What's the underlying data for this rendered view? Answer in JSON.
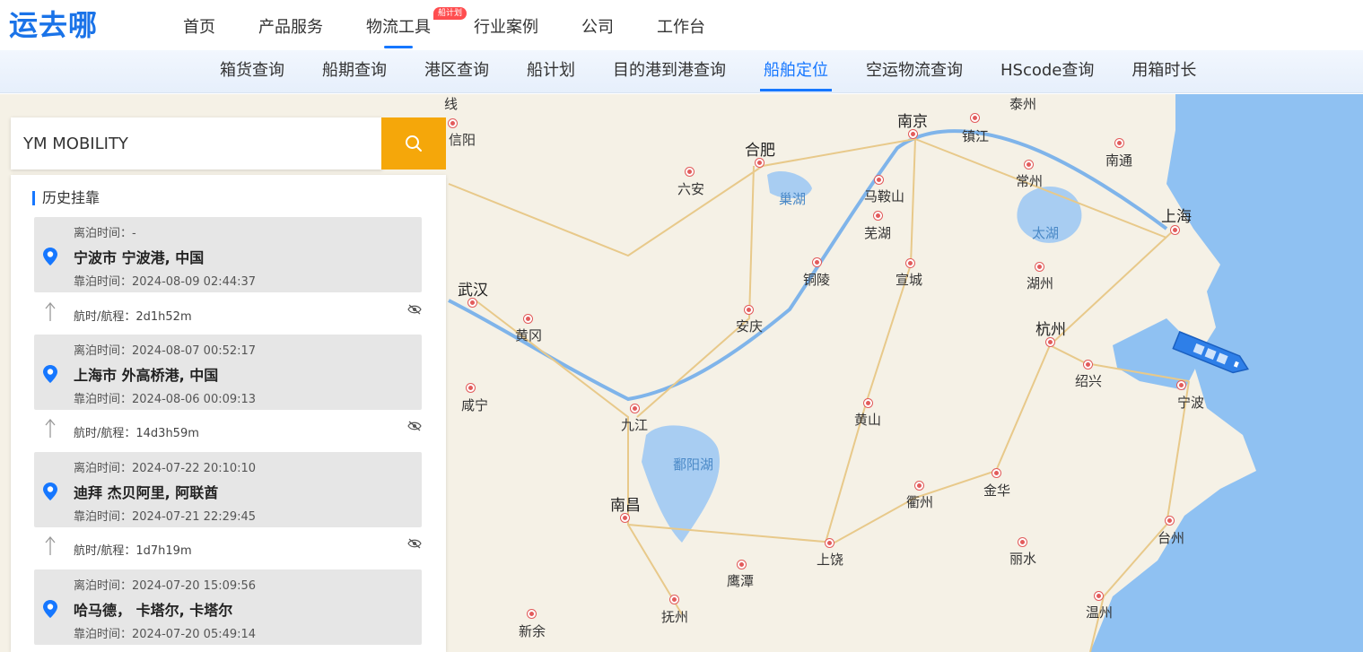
{
  "header": {
    "logo": "运去哪",
    "nav": [
      {
        "label": "首页"
      },
      {
        "label": "产品服务"
      },
      {
        "label": "物流工具",
        "badge": "船计划",
        "active": true
      },
      {
        "label": "行业案例"
      },
      {
        "label": "公司"
      },
      {
        "label": "工作台"
      }
    ]
  },
  "subnav": [
    {
      "label": "箱货查询"
    },
    {
      "label": "船期查询"
    },
    {
      "label": "港区查询"
    },
    {
      "label": "船计划"
    },
    {
      "label": "目的港到港查询"
    },
    {
      "label": "船舶定位",
      "active": true
    },
    {
      "label": "空运物流查询"
    },
    {
      "label": "HScode查询"
    },
    {
      "label": "用箱时长"
    }
  ],
  "search": {
    "value": "YM MOBILITY",
    "button_icon": "search-icon"
  },
  "history": {
    "title": "历史挂靠",
    "ports": [
      {
        "depart": "离泊时间：-",
        "name": "宁波市 宁波港, 中国",
        "arrive": "靠泊时间：2024-08-09 02:44:37"
      },
      {
        "depart": "离泊时间：2024-08-07 00:52:17",
        "name": "上海市 外高桥港, 中国",
        "arrive": "靠泊时间：2024-08-06 00:09:13"
      },
      {
        "depart": "离泊时间：2024-07-22 20:10:10",
        "name": "迪拜 杰贝阿里, 阿联酋",
        "arrive": "靠泊时间：2024-07-21 22:29:45"
      },
      {
        "depart": "离泊时间：2024-07-20 15:09:56",
        "name": "哈马德， 卡塔尔, 卡塔尔",
        "arrive": "靠泊时间：2024-07-20 05:49:14"
      }
    ],
    "voyages": [
      {
        "text": "航时/航程：2d1h52m"
      },
      {
        "text": "航时/航程：14d3h59m"
      },
      {
        "text": "航时/航程：1d7h19m"
      }
    ]
  },
  "map": {
    "colors": {
      "land": "#f5f1e6",
      "water": "#a8cdf2",
      "sea": "#8fc1f2",
      "ship": "#2e7fe8"
    },
    "labels": [
      {
        "text": "南京",
        "kind": "big"
      },
      {
        "text": "泰州"
      },
      {
        "text": "镇江"
      },
      {
        "text": "合肥",
        "kind": "big"
      },
      {
        "text": "六安"
      },
      {
        "text": "巢湖",
        "kind": "water"
      },
      {
        "text": "马鞍山"
      },
      {
        "text": "常州"
      },
      {
        "text": "南通"
      },
      {
        "text": "芜湖"
      },
      {
        "text": "太湖",
        "kind": "water"
      },
      {
        "text": "上海",
        "kind": "big"
      },
      {
        "text": "铜陵"
      },
      {
        "text": "宣城"
      },
      {
        "text": "湖州"
      },
      {
        "text": "武汉",
        "kind": "big"
      },
      {
        "text": "安庆"
      },
      {
        "text": "黄冈"
      },
      {
        "text": "杭州",
        "kind": "big"
      },
      {
        "text": "绍兴"
      },
      {
        "text": "宁波"
      },
      {
        "text": "咸宁"
      },
      {
        "text": "九江"
      },
      {
        "text": "黄山"
      },
      {
        "text": "鄱阳湖",
        "kind": "water"
      },
      {
        "text": "金华"
      },
      {
        "text": "衢州"
      },
      {
        "text": "南昌",
        "kind": "big"
      },
      {
        "text": "台州"
      },
      {
        "text": "上饶"
      },
      {
        "text": "丽水"
      },
      {
        "text": "鹰潭"
      },
      {
        "text": "抚州"
      },
      {
        "text": "温州"
      },
      {
        "text": "新余"
      },
      {
        "text": "信阳"
      },
      {
        "text": "线"
      }
    ]
  }
}
